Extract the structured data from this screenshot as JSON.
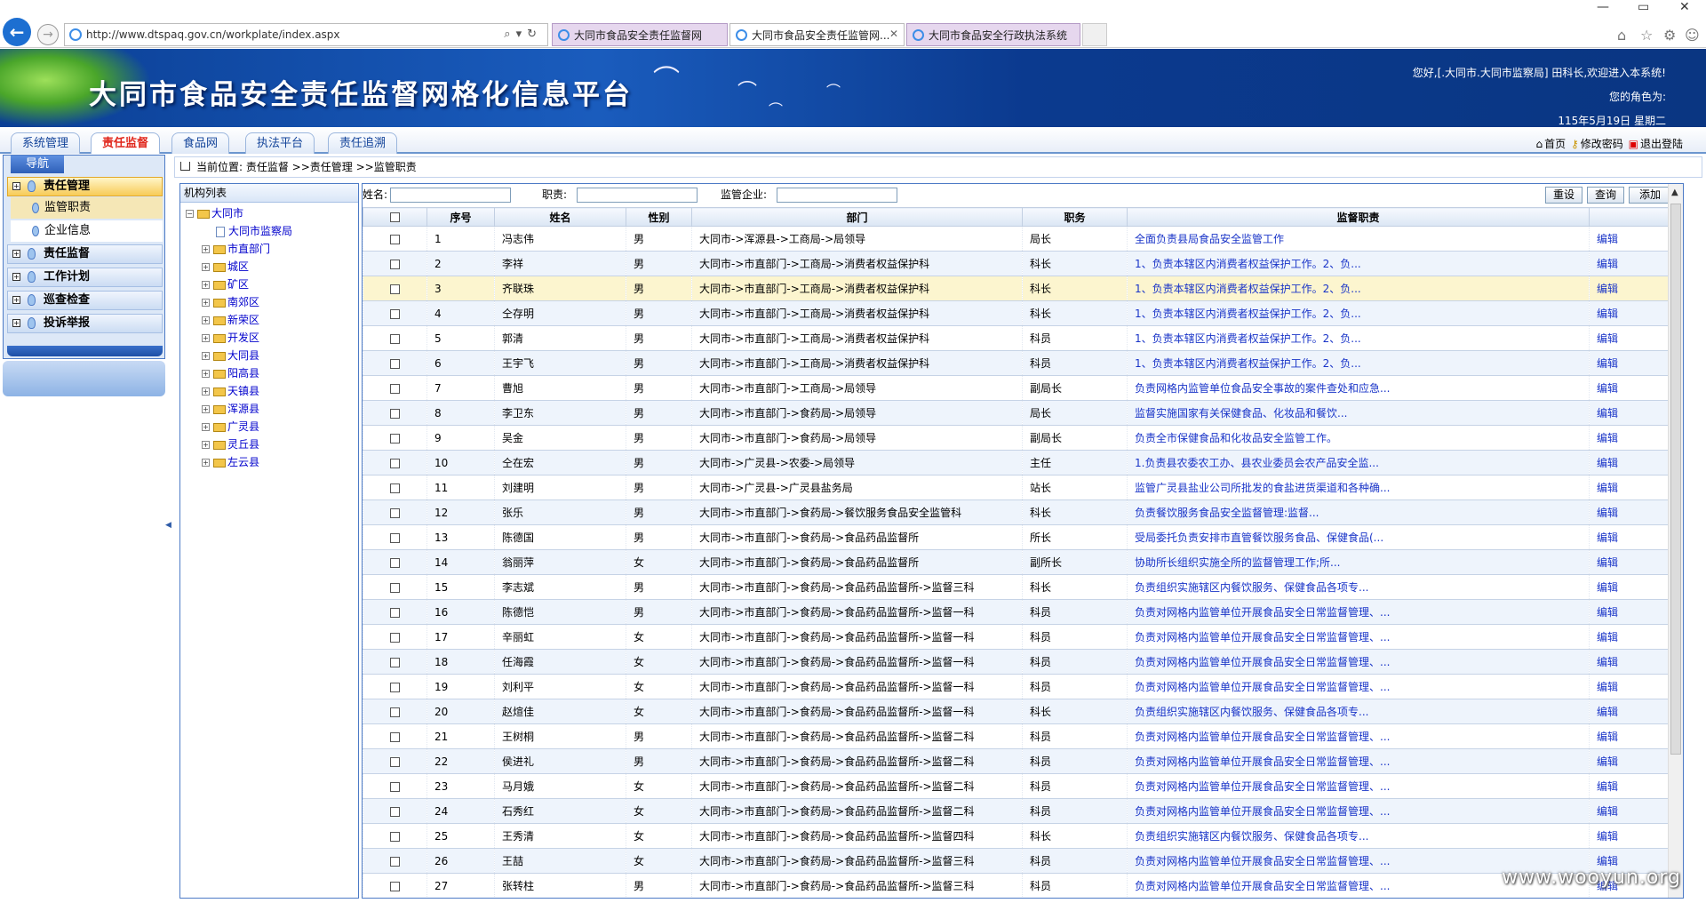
{
  "browser": {
    "url": "http://www.dtspaq.gov.cn/workplate/index.aspx",
    "tabs": [
      {
        "label": "大同市食品安全责任监督网"
      },
      {
        "label": "大同市食品安全责任监管网..."
      },
      {
        "label": "大同市食品安全行政执法系统"
      }
    ],
    "window_controls": [
      "—",
      "▭",
      "✕"
    ]
  },
  "header": {
    "title": "大同市食品安全责任监督网格化信息平台",
    "greeting": "您好,[.大同市.大同市监察局] 田科长,欢迎进入本系统!",
    "role_label": "您的角色为:",
    "date": "115年5月19日 星期二"
  },
  "menu": {
    "tabs": [
      "系统管理",
      "责任监督",
      "食品网",
      "执法平台",
      "责任追溯"
    ],
    "active_index": 1,
    "links": {
      "home": "首页",
      "change_password": "修改密码",
      "logout": "退出登陆"
    }
  },
  "nav": {
    "title": "导航",
    "groups": [
      "责任管理",
      "责任监督",
      "工作计划",
      "巡查检查",
      "投诉举报"
    ],
    "sub_items": [
      "监管职责",
      "企业信息"
    ]
  },
  "breadcrumb": "当前位置: 责任监督 >>责任管理 >>监管职责",
  "tree": {
    "title": "机构列表",
    "root": "大同市",
    "leaf": "大同市监察局",
    "children": [
      "市直部门",
      "城区",
      "矿区",
      "南郊区",
      "新荣区",
      "开发区",
      "大同县",
      "阳高县",
      "天镇县",
      "浑源县",
      "广灵县",
      "灵丘县",
      "左云县"
    ]
  },
  "filters": {
    "name_label": "姓名:",
    "position_label": "职责:",
    "enterprise_label": "监管企业:",
    "name_value": "",
    "position_value": "",
    "enterprise_value": "",
    "reset": "重设",
    "query": "查询",
    "add": "添加"
  },
  "table": {
    "headers": [
      "",
      "序号",
      "姓名",
      "性别",
      "部门",
      "职务",
      "监督职责",
      ""
    ],
    "edit_label": "编辑",
    "rows": [
      [
        "1",
        "冯志伟",
        "男",
        "大同市->浑源县->工商局->局领导",
        "局长",
        "全面负责县局食品安全监管工作"
      ],
      [
        "2",
        "李祥",
        "男",
        "大同市->市直部门->工商局->消费者权益保护科",
        "科长",
        "1、负责本辖区内消费者权益保护工作。2、负..."
      ],
      [
        "3",
        "齐联珠",
        "男",
        "大同市->市直部门->工商局->消费者权益保护科",
        "科长",
        "1、负责本辖区内消费者权益保护工作。2、负..."
      ],
      [
        "4",
        "仝存明",
        "男",
        "大同市->市直部门->工商局->消费者权益保护科",
        "科长",
        "1、负责本辖区内消费者权益保护工作。2、负..."
      ],
      [
        "5",
        "郭清",
        "男",
        "大同市->市直部门->工商局->消费者权益保护科",
        "科员",
        "1、负责本辖区内消费者权益保护工作。2、负..."
      ],
      [
        "6",
        "王宇飞",
        "男",
        "大同市->市直部门->工商局->消费者权益保护科",
        "科员",
        "1、负责本辖区内消费者权益保护工作。2、负..."
      ],
      [
        "7",
        "曹旭",
        "男",
        "大同市->市直部门->工商局->局领导",
        "副局长",
        "负责网格内监管单位食品安全事故的案件查处和应急..."
      ],
      [
        "8",
        "李卫东",
        "男",
        "大同市->市直部门->食药局->局领导",
        "局长",
        "监督实施国家有关保健食品、化妆品和餐饮..."
      ],
      [
        "9",
        "吴金",
        "男",
        "大同市->市直部门->食药局->局领导",
        "副局长",
        "负责全市保健食品和化妆品安全监管工作。"
      ],
      [
        "10",
        "仝在宏",
        "男",
        "大同市->广灵县->农委->局领导",
        "主任",
        "1.负责县农委农工办、县农业委员会农产品安全监..."
      ],
      [
        "11",
        "刘建明",
        "男",
        "大同市->广灵县->广灵县盐务局",
        "站长",
        "监管广灵县盐业公司所批发的食盐进货渠道和各种确..."
      ],
      [
        "12",
        "张乐",
        "男",
        "大同市->市直部门->食药局->餐饮服务食品安全监管科",
        "科长",
        "负责餐饮服务食品安全监督管理:监督..."
      ],
      [
        "13",
        "陈德国",
        "男",
        "大同市->市直部门->食药局->食品药品监督所",
        "所长",
        "受局委托负责安排市直管餐饮服务食品、保健食品(..."
      ],
      [
        "14",
        "翁丽萍",
        "女",
        "大同市->市直部门->食药局->食品药品监督所",
        "副所长",
        "协助所长组织实施全所的监督管理工作;所..."
      ],
      [
        "15",
        "李志斌",
        "男",
        "大同市->市直部门->食药局->食品药品监督所->监督三科",
        "科长",
        "负责组织实施辖区内餐饮服务、保健食品各项专..."
      ],
      [
        "16",
        "陈德恺",
        "男",
        "大同市->市直部门->食药局->食品药品监督所->监督一科",
        "科员",
        "负责对网格内监管单位开展食品安全日常监督管理、..."
      ],
      [
        "17",
        "辛丽虹",
        "女",
        "大同市->市直部门->食药局->食品药品监督所->监督一科",
        "科员",
        "负责对网格内监管单位开展食品安全日常监督管理、..."
      ],
      [
        "18",
        "任海霞",
        "女",
        "大同市->市直部门->食药局->食品药品监督所->监督一科",
        "科员",
        "负责对网格内监管单位开展食品安全日常监督管理、..."
      ],
      [
        "19",
        "刘利平",
        "女",
        "大同市->市直部门->食药局->食品药品监督所->监督一科",
        "科员",
        "负责对网格内监管单位开展食品安全日常监督管理、..."
      ],
      [
        "20",
        "赵煊佳",
        "女",
        "大同市->市直部门->食药局->食品药品监督所->监督一科",
        "科长",
        "负责组织实施辖区内餐饮服务、保健食品各项专..."
      ],
      [
        "21",
        "王树桐",
        "男",
        "大同市->市直部门->食药局->食品药品监督所->监督二科",
        "科员",
        "负责对网格内监管单位开展食品安全日常监督管理、..."
      ],
      [
        "22",
        "侯进礼",
        "男",
        "大同市->市直部门->食药局->食品药品监督所->监督二科",
        "科员",
        "负责对网格内监管单位开展食品安全日常监督管理、..."
      ],
      [
        "23",
        "马月娥",
        "女",
        "大同市->市直部门->食药局->食品药品监督所->监督二科",
        "科员",
        "负责对网格内监管单位开展食品安全日常监督管理、..."
      ],
      [
        "24",
        "石秀红",
        "女",
        "大同市->市直部门->食药局->食品药品监督所->监督二科",
        "科员",
        "负责对网格内监管单位开展食品安全日常监督管理、..."
      ],
      [
        "25",
        "王秀清",
        "女",
        "大同市->市直部门->食药局->食品药品监督所->监督四科",
        "科长",
        "负责组织实施辖区内餐饮服务、保健食品各项专..."
      ],
      [
        "26",
        "王喆",
        "女",
        "大同市->市直部门->食药局->食品药品监督所->监督三科",
        "科员",
        "负责对网格内监管单位开展食品安全日常监督管理、..."
      ],
      [
        "27",
        "张转柱",
        "男",
        "大同市->市直部门->食药局->食品药品监督所->监督三科",
        "科员",
        "负责对网格内监管单位开展食品安全日常监督管理、..."
      ]
    ]
  },
  "watermark": "www.wooyun.org"
}
